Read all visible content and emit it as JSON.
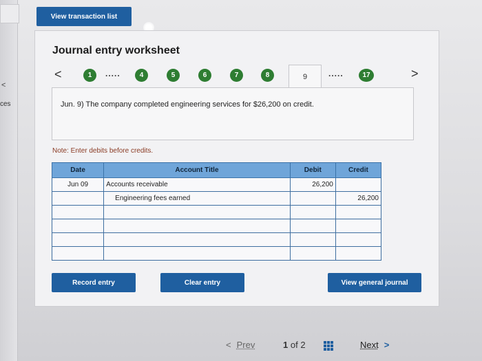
{
  "sidebar": {
    "chevron": "<",
    "label": "ces"
  },
  "header": {
    "view_transaction_list": "View transaction list"
  },
  "worksheet": {
    "title": "Journal entry worksheet",
    "prev_arrow": "<",
    "next_arrow": ">",
    "steps": [
      "1",
      "4",
      "5",
      "6",
      "7",
      "8"
    ],
    "dots": ".....",
    "active_step": "9",
    "last_step": "17",
    "question": "Jun. 9) The company completed engineering services for $26,200 on credit.",
    "note": "Note: Enter debits before credits.",
    "table": {
      "headers": {
        "date": "Date",
        "account": "Account Title",
        "debit": "Debit",
        "credit": "Credit"
      },
      "rows": [
        {
          "date": "Jun 09",
          "account": "Accounts receivable",
          "debit": "26,200",
          "credit": ""
        },
        {
          "date": "",
          "account": "Engineering fees earned",
          "debit": "",
          "credit": "26,200"
        },
        {
          "date": "",
          "account": "",
          "debit": "",
          "credit": ""
        },
        {
          "date": "",
          "account": "",
          "debit": "",
          "credit": ""
        },
        {
          "date": "",
          "account": "",
          "debit": "",
          "credit": ""
        },
        {
          "date": "",
          "account": "",
          "debit": "",
          "credit": ""
        }
      ]
    },
    "buttons": {
      "record": "Record entry",
      "clear": "Clear entry",
      "view_journal": "View general journal"
    }
  },
  "pager": {
    "prev_chevron": "<",
    "prev": "Prev",
    "current": "1",
    "of": "of",
    "total": "2",
    "next": "Next",
    "next_chevron": ">"
  },
  "colors": {
    "accent": "#1f5fa0",
    "step_done": "#2e7d32",
    "table_header": "#6fa5d9"
  }
}
